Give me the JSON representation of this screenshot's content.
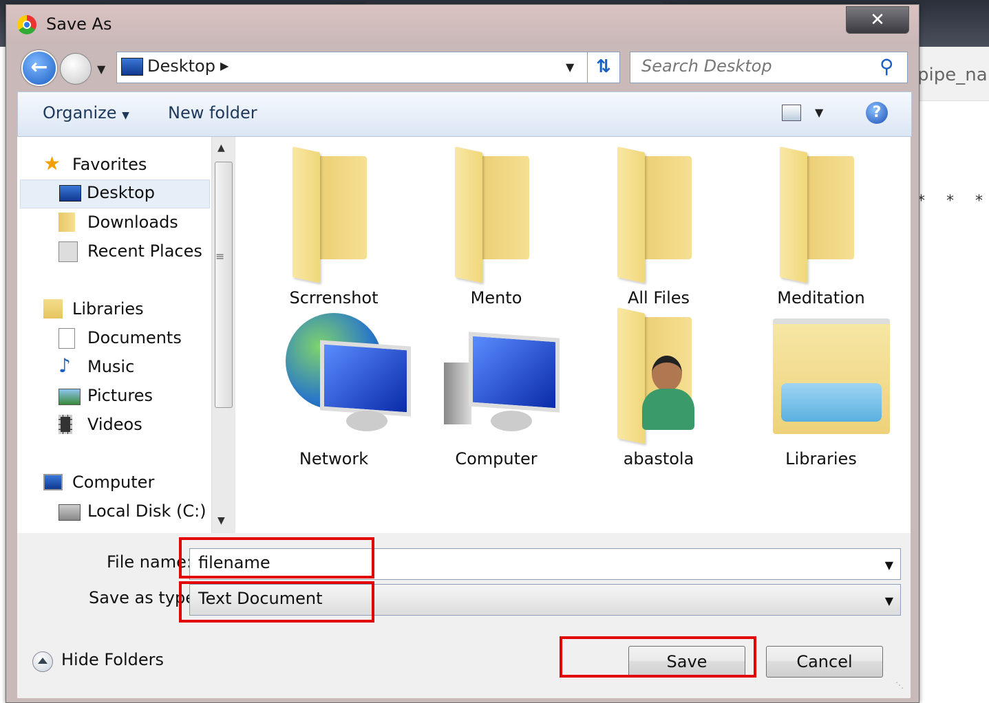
{
  "window": {
    "title": "Save As",
    "close_glyph": "✕"
  },
  "background": {
    "partial_text": "pipe_nar",
    "stars": "* * *"
  },
  "nav": {
    "address_location": "Desktop",
    "search_placeholder": "Search Desktop"
  },
  "toolbar": {
    "organize_label": "Organize",
    "new_folder_label": "New folder"
  },
  "sidebar": {
    "items": [
      {
        "label": "Favorites",
        "icon": "star-icon"
      },
      {
        "label": "Desktop",
        "icon": "desktop-icon"
      },
      {
        "label": "Downloads",
        "icon": "downloads-icon"
      },
      {
        "label": "Recent Places",
        "icon": "recent-places-icon"
      },
      {
        "label": "Libraries",
        "icon": "libraries-icon"
      },
      {
        "label": "Documents",
        "icon": "documents-icon"
      },
      {
        "label": "Music",
        "icon": "music-icon"
      },
      {
        "label": "Pictures",
        "icon": "pictures-icon"
      },
      {
        "label": "Videos",
        "icon": "videos-icon"
      },
      {
        "label": "Computer",
        "icon": "computer-icon"
      },
      {
        "label": "Local Disk (C:)",
        "icon": "local-disk-icon"
      }
    ]
  },
  "files": [
    {
      "label": "Scrrenshot",
      "icon": "folder-icon"
    },
    {
      "label": "Mento",
      "icon": "folder-icon"
    },
    {
      "label": "All Files",
      "icon": "folder-icon"
    },
    {
      "label": "Meditation",
      "icon": "folder-icon"
    },
    {
      "label": "Network",
      "icon": "network-icon"
    },
    {
      "label": "Computer",
      "icon": "computer-icon"
    },
    {
      "label": "abastola",
      "icon": "user-folder-icon"
    },
    {
      "label": "Libraries",
      "icon": "libraries-icon"
    }
  ],
  "form": {
    "file_name_label": "File name:",
    "file_name_value": "filename",
    "save_as_type_label": "Save as type:",
    "save_as_type_value": "Text Document"
  },
  "footer": {
    "hide_folders_label": "Hide Folders",
    "save_label": "Save",
    "cancel_label": "Cancel"
  },
  "colors": {
    "highlight": "#e20000",
    "accent": "#1a5fc4"
  }
}
